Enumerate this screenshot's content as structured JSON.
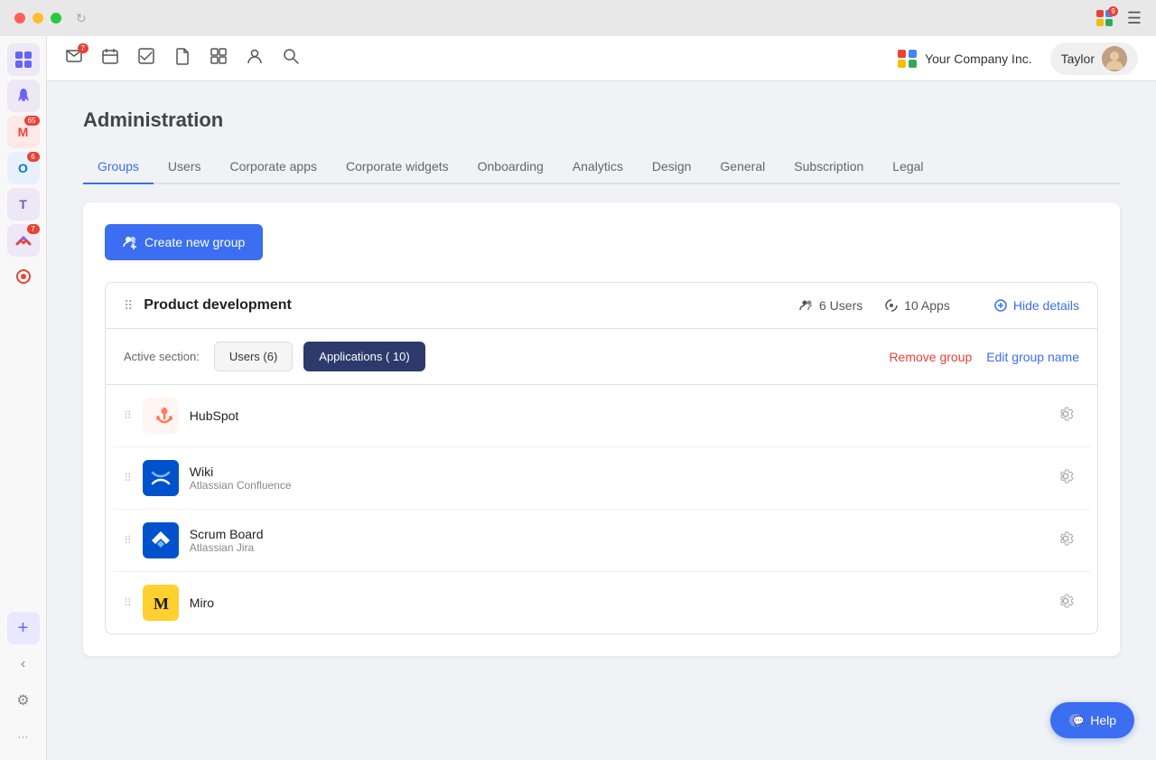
{
  "titlebar": {
    "loader_visible": true,
    "grid_label": "apps-grid",
    "menu_label": "menu"
  },
  "left_sidebar": {
    "icons": [
      {
        "id": "main-app",
        "emoji": "⠿",
        "badge": null,
        "active": true,
        "color": "#6366f1"
      },
      {
        "id": "rocket",
        "emoji": "🚀",
        "badge": null,
        "active": false,
        "color": "#6366f1"
      },
      {
        "id": "gmail",
        "emoji": "M",
        "badge": "65",
        "active": false,
        "color": "#ea4335",
        "bg": "#fce8e6"
      },
      {
        "id": "outlook",
        "emoji": "O",
        "badge": "6",
        "active": false,
        "color": "#0078d4",
        "bg": "#e8f0fe"
      },
      {
        "id": "teams",
        "emoji": "T",
        "badge": null,
        "active": false,
        "color": "#6264a7",
        "bg": "#ede7f6"
      },
      {
        "id": "clickup",
        "emoji": "C",
        "badge": "7",
        "active": false,
        "color": "#7b68ee",
        "bg": "#ede7f6"
      },
      {
        "id": "round",
        "emoji": "◉",
        "badge": null,
        "active": false,
        "color": "#e94235"
      }
    ],
    "bottom_icons": [
      {
        "id": "add",
        "emoji": "＋",
        "active": false
      },
      {
        "id": "back",
        "emoji": "‹",
        "active": false
      },
      {
        "id": "settings",
        "emoji": "⚙",
        "active": false
      },
      {
        "id": "more",
        "emoji": "···",
        "active": false
      }
    ]
  },
  "topbar": {
    "icons": [
      {
        "id": "inbox",
        "icon": "✉",
        "badge": "7"
      },
      {
        "id": "calendar",
        "icon": "📅",
        "badge": null
      },
      {
        "id": "tasks",
        "icon": "✓",
        "badge": null
      },
      {
        "id": "doc",
        "icon": "📄",
        "badge": null
      },
      {
        "id": "grid",
        "icon": "⊞",
        "badge": null
      },
      {
        "id": "person",
        "icon": "👤",
        "badge": null
      },
      {
        "id": "search",
        "icon": "🔍",
        "badge": null
      }
    ],
    "company": {
      "name": "Your Company Inc.",
      "logo_colors": [
        "#e94235",
        "#4285f4",
        "#fbbc05",
        "#34a853"
      ]
    },
    "user": {
      "name": "Taylor"
    }
  },
  "page": {
    "title": "Administration"
  },
  "tabs": [
    {
      "id": "groups",
      "label": "Groups",
      "active": true
    },
    {
      "id": "users",
      "label": "Users",
      "active": false
    },
    {
      "id": "corporate-apps",
      "label": "Corporate apps",
      "active": false
    },
    {
      "id": "corporate-widgets",
      "label": "Corporate widgets",
      "active": false
    },
    {
      "id": "onboarding",
      "label": "Onboarding",
      "active": false
    },
    {
      "id": "analytics",
      "label": "Analytics",
      "active": false
    },
    {
      "id": "design",
      "label": "Design",
      "active": false
    },
    {
      "id": "general",
      "label": "General",
      "active": false
    },
    {
      "id": "subscription",
      "label": "Subscription",
      "active": false
    },
    {
      "id": "legal",
      "label": "Legal",
      "active": false
    }
  ],
  "create_group_btn": "Create new group",
  "group": {
    "name": "Product development",
    "users_count": "6 Users",
    "apps_count": "10 Apps",
    "hide_details_label": "Hide details",
    "active_section_label": "Active section:",
    "users_tab": "Users (6)",
    "applications_tab": "Applications ( 10)",
    "remove_group": "Remove group",
    "edit_group_name": "Edit group name"
  },
  "apps": [
    {
      "id": "hubspot",
      "name": "HubSpot",
      "sub": "",
      "icon_type": "hubspot",
      "icon_emoji": "⚙"
    },
    {
      "id": "wiki",
      "name": "Wiki",
      "sub": "Atlassian Confluence",
      "icon_type": "confluence"
    },
    {
      "id": "scrum-board",
      "name": "Scrum Board",
      "sub": "Atlassian Jira",
      "icon_type": "jira"
    },
    {
      "id": "miro",
      "name": "Miro",
      "sub": "",
      "icon_type": "miro"
    }
  ],
  "help_btn": "Help"
}
